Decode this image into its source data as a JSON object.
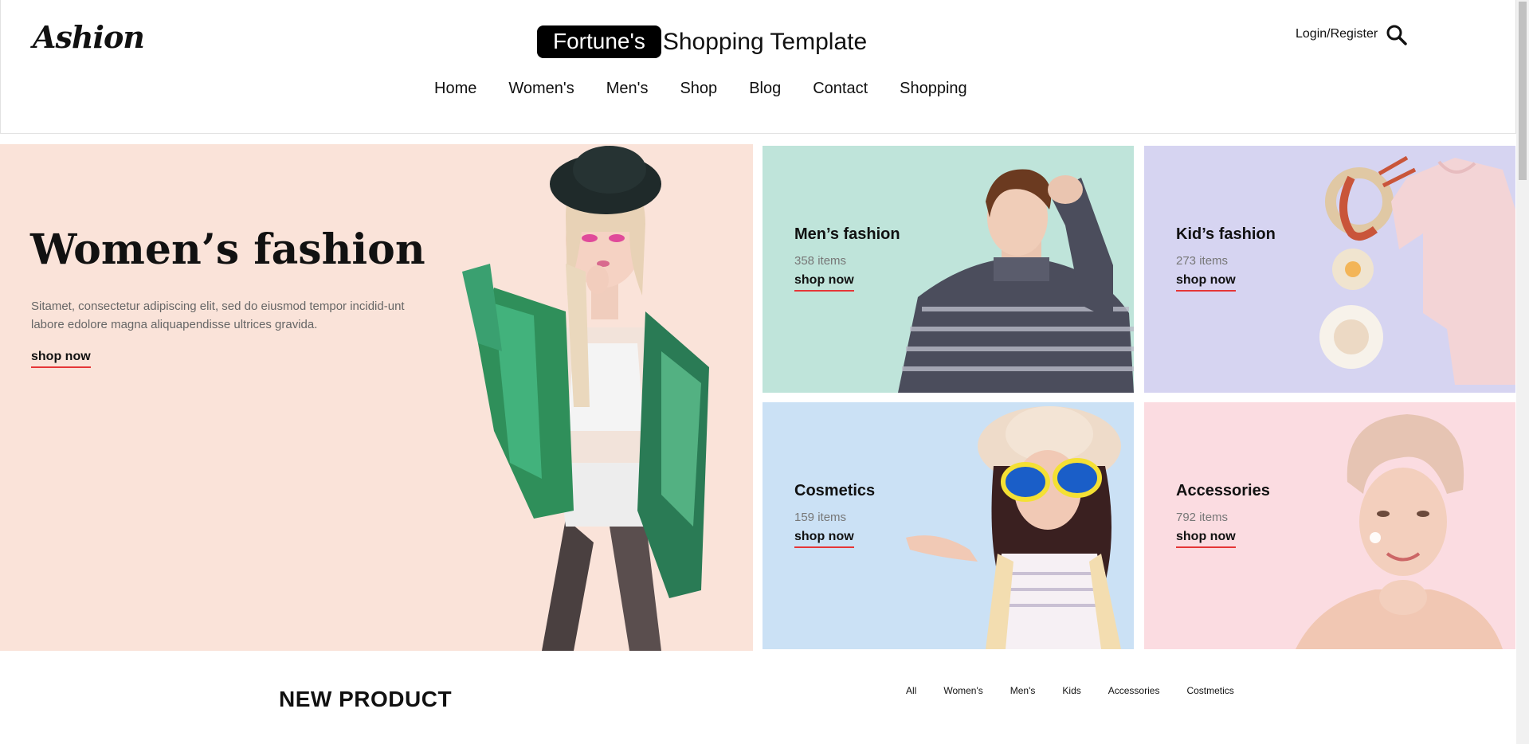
{
  "header": {
    "logo": "Ashion",
    "brand_badge": "Fortune's",
    "brand_rest": "Shopping Template",
    "nav": [
      "Home",
      "Women's",
      "Men's",
      "Shop",
      "Blog",
      "Contact",
      "Shopping"
    ],
    "login": "Login/Register",
    "search_icon": "search-icon"
  },
  "hero": {
    "title": "Women’s fashion",
    "description": "Sitamet, consectetur adipiscing elit, sed do eiusmod tempor incidid-unt labore edolore magna aliquapendisse ultrices gravida.",
    "shop": "shop now"
  },
  "tiles": [
    {
      "title": "Men’s fashion",
      "count": "358 items",
      "shop": "shop now",
      "color": "#bfe4da"
    },
    {
      "title": "Kid’s fashion",
      "count": "273 items",
      "shop": "shop now",
      "color": "#d6d4f1"
    },
    {
      "title": "Cosmetics",
      "count": "159 items",
      "shop": "shop now",
      "color": "#cbe1f5"
    },
    {
      "title": "Accessories",
      "count": "792 items",
      "shop": "shop now",
      "color": "#fbdce1"
    }
  ],
  "new_product": {
    "title": "NEW PRODUCT",
    "filters": [
      "All",
      "Women's",
      "Men's",
      "Kids",
      "Accessories",
      "Costmetics"
    ]
  },
  "colors": {
    "accent": "#e53637",
    "hero_bg": "#fae3d9"
  }
}
